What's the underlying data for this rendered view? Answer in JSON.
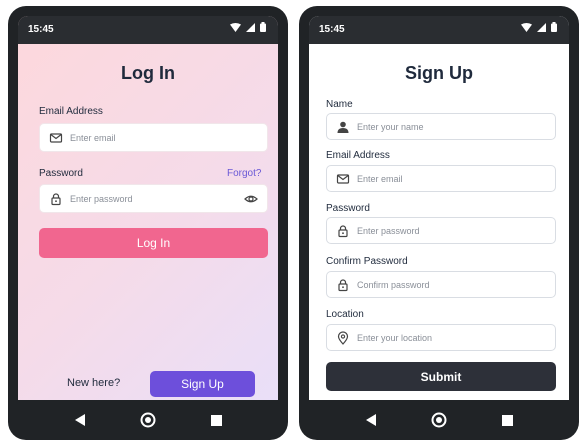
{
  "login_screen": {
    "status_time": "15:45",
    "title": "Log In",
    "email_label": "Email Address",
    "email_placeholder": "Enter email",
    "password_label": "Password",
    "forgot_link": "Forgot?",
    "password_placeholder": "Enter password",
    "login_button": "Log In",
    "new_here": "New here?",
    "signup_button": "Sign Up"
  },
  "signup_screen": {
    "status_time": "15:45",
    "title": "Sign Up",
    "name_label": "Name",
    "name_placeholder": "Enter your name",
    "email_label": "Email Address",
    "email_placeholder": "Enter email",
    "password_label": "Password",
    "password_placeholder": "Enter password",
    "confirm_label": "Confirm Password",
    "confirm_placeholder": "Confirm password",
    "location_label": "Location",
    "location_placeholder": "Enter your location",
    "submit_button": "Submit"
  },
  "icons": {
    "email": "mail-icon",
    "password": "lock-icon",
    "show_password": "eye-icon",
    "name": "person-icon",
    "location": "map-pin-icon",
    "wifi": "wifi-icon",
    "signal": "signal-icon",
    "battery": "battery-icon",
    "back": "back-triangle-icon",
    "home": "home-circle-icon",
    "recents": "recents-square-icon"
  },
  "colors": {
    "login_button": "#f1668f",
    "signup_button": "#6d4fdb",
    "submit_button": "#2d3039",
    "link": "#6a59d6"
  }
}
